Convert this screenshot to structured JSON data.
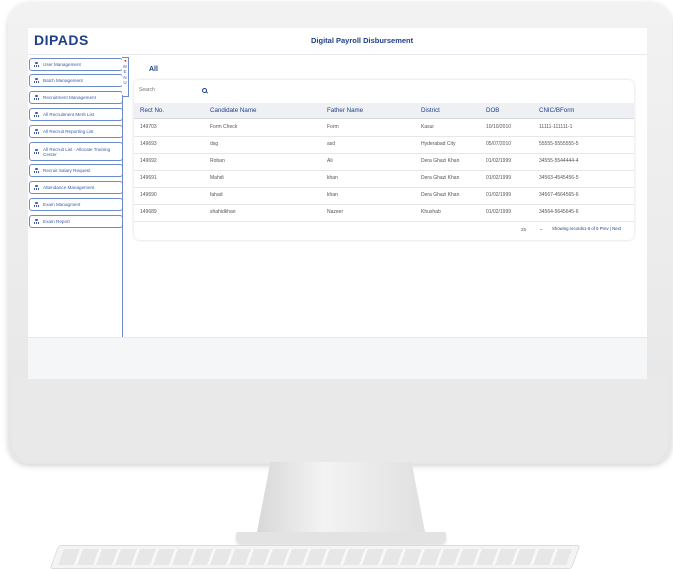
{
  "app": {
    "logo": "DIPADS",
    "title": "Digital Payroll Disbursement"
  },
  "sidebar": {
    "items": [
      {
        "label": "User Management"
      },
      {
        "label": "Batch Management"
      },
      {
        "label": "Recruitment Management"
      },
      {
        "label": "All Recruitment Merit List"
      },
      {
        "label": "All Recruit Reporting List"
      },
      {
        "label": "All Recruit List - Allocate Training Center"
      },
      {
        "label": "Recruit Salary Request"
      },
      {
        "label": "Attendance Management"
      },
      {
        "label": "Exam Managment"
      },
      {
        "label": "Exam Report"
      }
    ],
    "menu_tab": {
      "arrow": "◄",
      "letters": [
        "M",
        "E",
        "N",
        "U"
      ]
    }
  },
  "main": {
    "heading": "All",
    "search": {
      "placeholder": "Search",
      "value": ""
    },
    "columns": [
      "Rect No.",
      "Candidate Name",
      "Father Name",
      "District",
      "DOB",
      "CNIC/BForm"
    ],
    "rows": [
      [
        "149703",
        "Form Check",
        "Form",
        "Kasur",
        "10/10/2010",
        "11111-111111-1"
      ],
      [
        "149693",
        "dsg",
        "asd",
        "Hyderabad City",
        "05/07/2010",
        "55555-5555555-5"
      ],
      [
        "149692",
        "Roban",
        "Ali",
        "Dera Ghazi Khan",
        "01/02/1999",
        "34555-5544444-4"
      ],
      [
        "149691",
        "Mahdi",
        "khan",
        "Dera Ghazi Khan",
        "01/02/1999",
        "34563-4545456-5"
      ],
      [
        "149690",
        "fahad",
        "khan",
        "Dera Ghazi Khan",
        "01/02/1999",
        "34567-4564565-6"
      ],
      [
        "149689",
        "shahidkhan",
        "Nazeer",
        "Khushab",
        "01/02/1999",
        "34564-5645645-6"
      ]
    ],
    "page_size": "25",
    "page_size_caret": "⌄",
    "status": "Showing records1-6 of 6 Prev | Next"
  },
  "colors": {
    "brand": "#1e3f8a",
    "border": "#6b8ccc",
    "header_bg": "#eef0f4"
  }
}
